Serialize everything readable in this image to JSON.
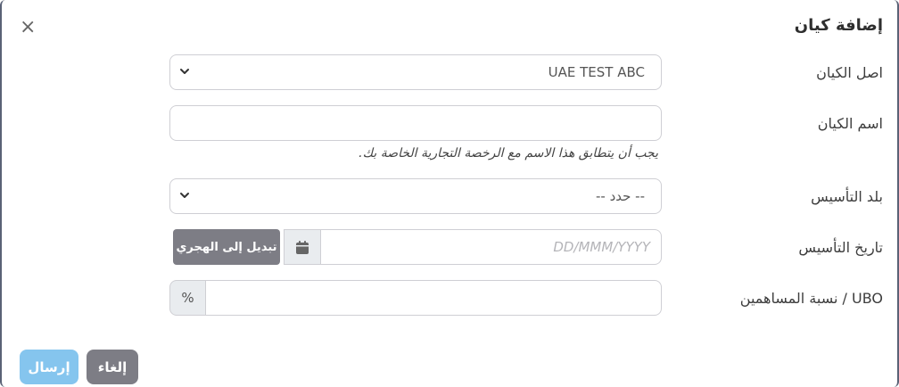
{
  "modal": {
    "title": "إضافة كيان",
    "close_symbol": "×"
  },
  "form": {
    "entity_origin": {
      "label": "اصل الكيان",
      "value": "UAE TEST ABC"
    },
    "entity_name": {
      "label": "اسم الكيان",
      "value": "",
      "hint": "يجب أن يتطابق هذا الاسم مع الرخصة التجارية الخاصة بك."
    },
    "country_of_incorporation": {
      "label": "بلد التأسيس",
      "value": "-- حدد --"
    },
    "date_of_incorporation": {
      "label": "تاريخ التأسيس",
      "placeholder": "DD/MMM/YYYY",
      "hijri_button": "تبديل إلى الهجري"
    },
    "ubo_percentage": {
      "label": "UBO / نسبة المساهمين",
      "addon": "%",
      "value": ""
    }
  },
  "footer": {
    "cancel_label": "إلغاء",
    "submit_label": "إرسال"
  },
  "colors": {
    "submit": "#85c5ee",
    "secondary": "#7d7d85",
    "addon_bg": "#e9ecef",
    "border": "#cfcfd4"
  },
  "icons": {
    "close": "close-icon",
    "chevron": "chevron-down-icon",
    "calendar": "calendar-icon"
  }
}
